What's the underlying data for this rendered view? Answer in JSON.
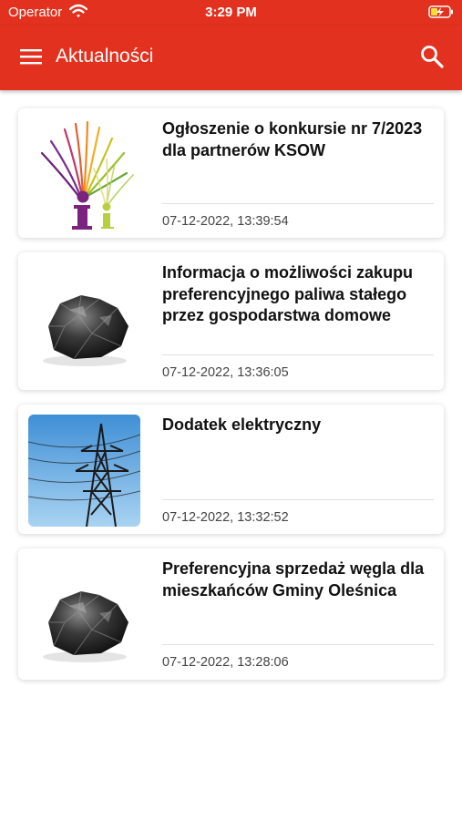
{
  "status_bar": {
    "carrier": "Operator",
    "time": "3:29 PM",
    "icons": [
      "wifi-icon",
      "battery-charging-icon"
    ]
  },
  "app_bar": {
    "title": "Aktualności",
    "icons": [
      "menu-icon",
      "search-icon"
    ]
  },
  "colors": {
    "brand": "#e3311f",
    "background": "#ffffff",
    "date_text": "#444444"
  },
  "news": [
    {
      "title": "Ogłoszenie o konkursie nr 7/2023 dla partnerów KSOW",
      "date": "07-12-2022, 13:39:54",
      "thumbnail": "information-tree-logo"
    },
    {
      "title": "Informacja o możliwości zakupu preferencyjnego paliwa stałego przez gospodarstwa domowe",
      "date": "07-12-2022, 13:36:05",
      "thumbnail": "coal-lump"
    },
    {
      "title": "Dodatek elektryczny",
      "date": "07-12-2022, 13:32:52",
      "thumbnail": "power-pylon"
    },
    {
      "title": "Preferencyjna sprzedaż węgla dla mieszkańców Gminy Oleśnica",
      "date": "07-12-2022, 13:28:06",
      "thumbnail": "coal-lump"
    }
  ]
}
